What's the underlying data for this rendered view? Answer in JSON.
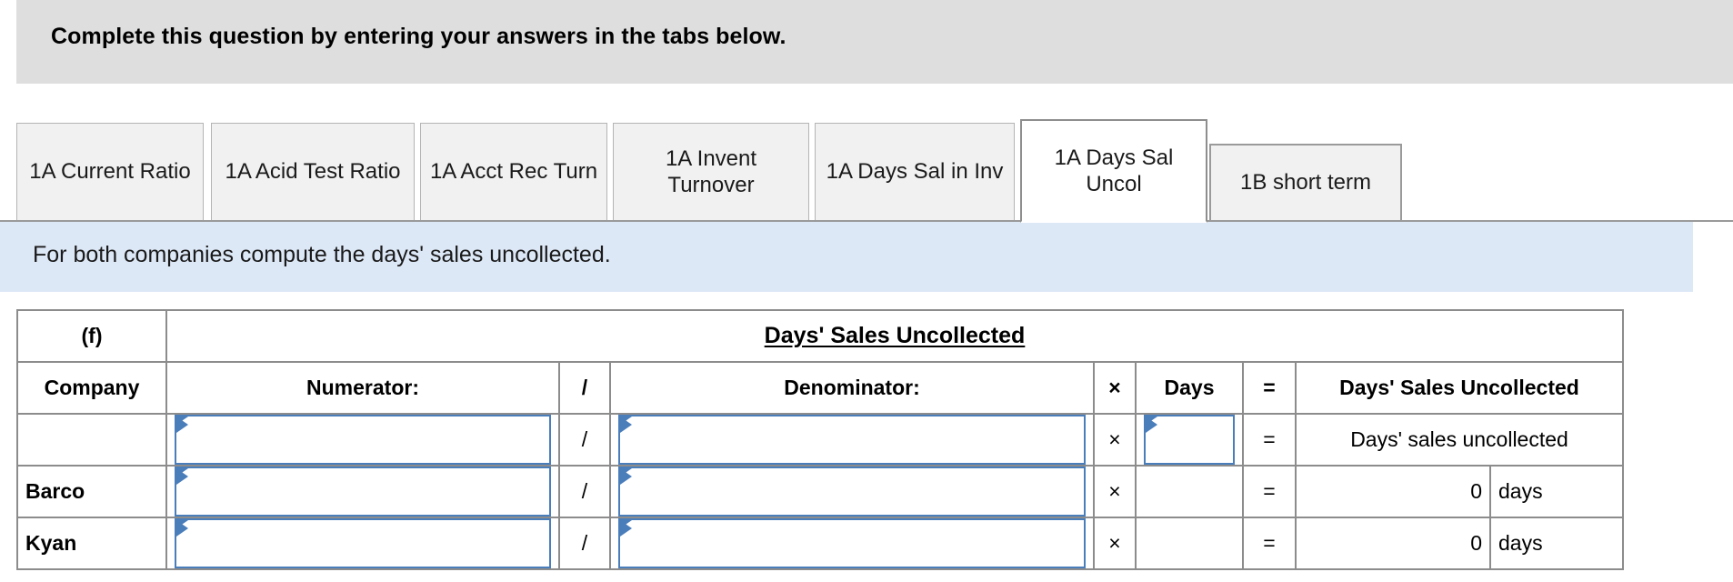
{
  "banner": {
    "instruction": "Complete this question by entering your answers in the tabs below."
  },
  "tabs": {
    "items": [
      {
        "label": "1A Current Ratio",
        "active": false
      },
      {
        "label": "1A Acid Test Ratio",
        "active": false
      },
      {
        "label": "1A Acct Rec Turn",
        "active": false
      },
      {
        "label": "1A Invent Turnover",
        "active": false
      },
      {
        "label": "1A Days Sal in Inv",
        "active": false
      },
      {
        "label": "1A Days Sal Uncol",
        "active": true
      },
      {
        "label": "1B short term",
        "active": false
      }
    ]
  },
  "subbar": {
    "instruction": "For both companies compute the days' sales uncollected."
  },
  "table": {
    "title_row": {
      "part_label": "(f)",
      "title": "Days' Sales Uncollected"
    },
    "columns": {
      "company": "Company",
      "numerator": "Numerator:",
      "divide": "/",
      "denominator": "Denominator:",
      "times": "×",
      "days": "Days",
      "equals": "=",
      "result": "Days' Sales Uncollected"
    },
    "rows": [
      {
        "company": "",
        "numerator": "",
        "divide": "/",
        "denominator": "",
        "times": "×",
        "days": "",
        "equals": "=",
        "result": "Days' sales uncollected",
        "unit": "",
        "numerator_input": true,
        "denominator_input": true,
        "days_input": true,
        "result_merged": true
      },
      {
        "company": "Barco",
        "numerator": "",
        "divide": "/",
        "denominator": "",
        "times": "×",
        "days": "",
        "equals": "=",
        "result": "0",
        "unit": "days",
        "numerator_input": true,
        "denominator_input": true,
        "days_input": false,
        "result_merged": false
      },
      {
        "company": "Kyan",
        "numerator": "",
        "divide": "/",
        "denominator": "",
        "times": "×",
        "days": "",
        "equals": "=",
        "result": "0",
        "unit": "days",
        "numerator_input": true,
        "denominator_input": true,
        "days_input": false,
        "result_merged": false
      }
    ]
  },
  "colors": {
    "banner_gray": "#dedede",
    "subbar_blue": "#dde8f7",
    "header_blue": "#80aae3",
    "input_border": "#4a7ebb",
    "grid_line": "#8c8c8c"
  }
}
